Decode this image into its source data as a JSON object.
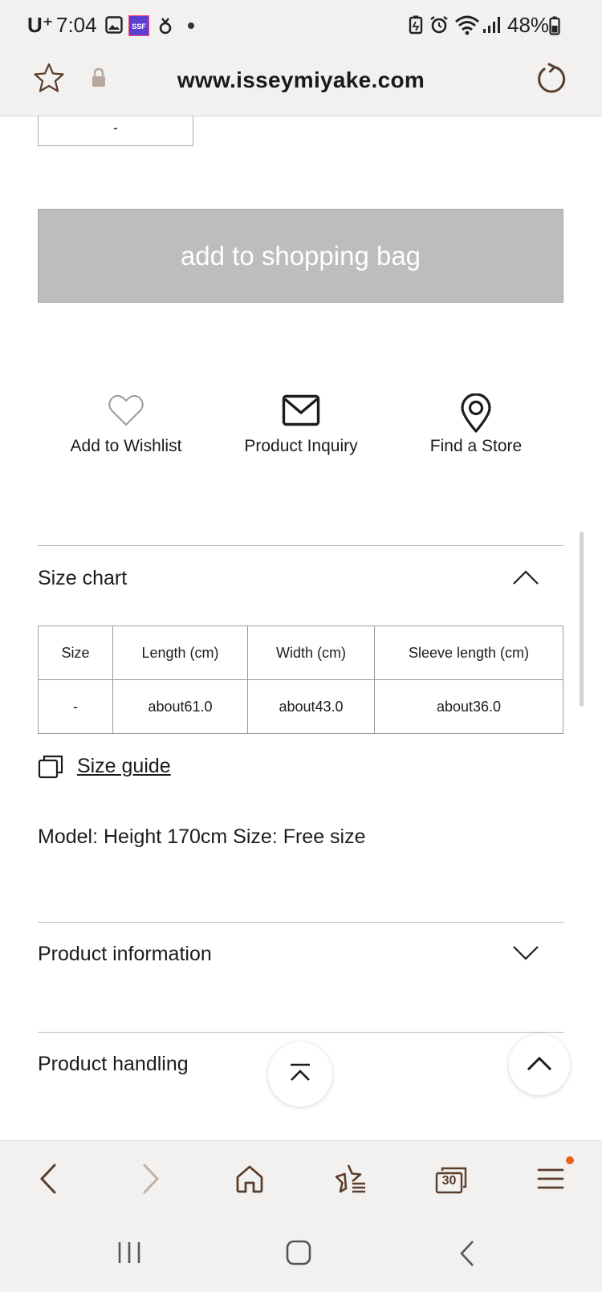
{
  "status_bar": {
    "time": "7:04",
    "carrier": "U⁺",
    "battery": "48%",
    "app_badge": "SSF",
    "icons": [
      "gallery-icon",
      "ssf-app-icon",
      "android-icon",
      "dot-icon",
      "battery-saver-icon",
      "alarm-icon",
      "wifi-icon",
      "signal-icon",
      "battery-icon"
    ]
  },
  "browser": {
    "url": "www.isseymiyake.com",
    "tab_count": "30"
  },
  "product": {
    "quantity_value": "-",
    "add_to_bag_label": "add to shopping bag"
  },
  "actions": [
    {
      "label": "Add to Wishlist",
      "icon": "heart-icon"
    },
    {
      "label": "Product Inquiry",
      "icon": "envelope-icon"
    },
    {
      "label": "Find a Store",
      "icon": "location-pin-icon"
    }
  ],
  "size_chart": {
    "title": "Size chart",
    "headers": [
      "Size",
      "Length (cm)",
      "Width (cm)",
      "Sleeve length (cm)"
    ],
    "rows": [
      [
        "-",
        "about61.0",
        "about43.0",
        "about36.0"
      ]
    ],
    "size_guide_label": "Size guide",
    "model_text": "Model: Height 170cm Size: Free size"
  },
  "sections": {
    "product_information": "Product information",
    "product_handling": "Product handling"
  },
  "colors": {
    "chrome_bg": "#f3f1ef",
    "button_disabled": "#bdbdbd",
    "icon_brown": "#5a3d2b",
    "notification_dot": "#e8621a"
  }
}
